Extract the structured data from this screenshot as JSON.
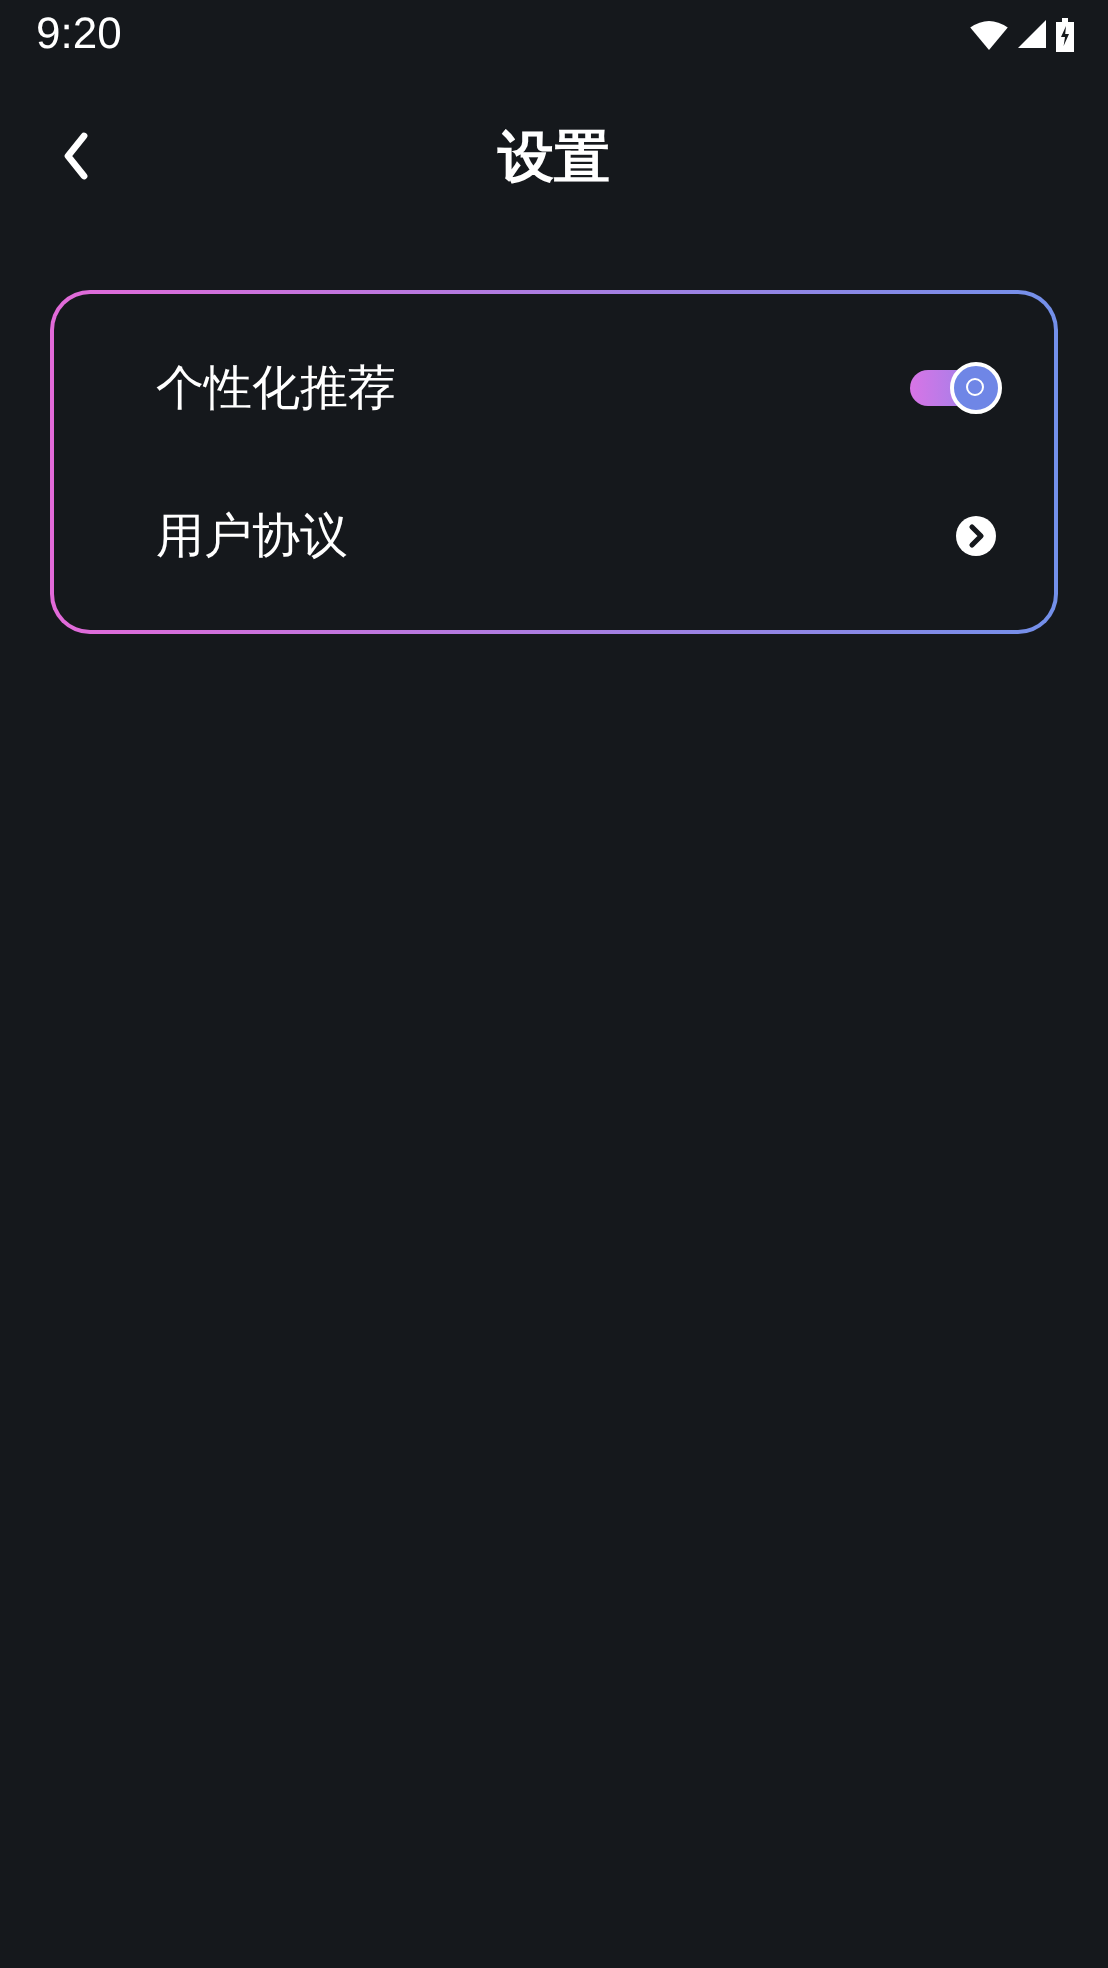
{
  "status_bar": {
    "time": "9:20"
  },
  "header": {
    "title": "设置"
  },
  "settings": [
    {
      "kind": "toggle",
      "label": "个性化推荐",
      "on": true
    },
    {
      "kind": "link",
      "label": "用户协议"
    }
  ]
}
